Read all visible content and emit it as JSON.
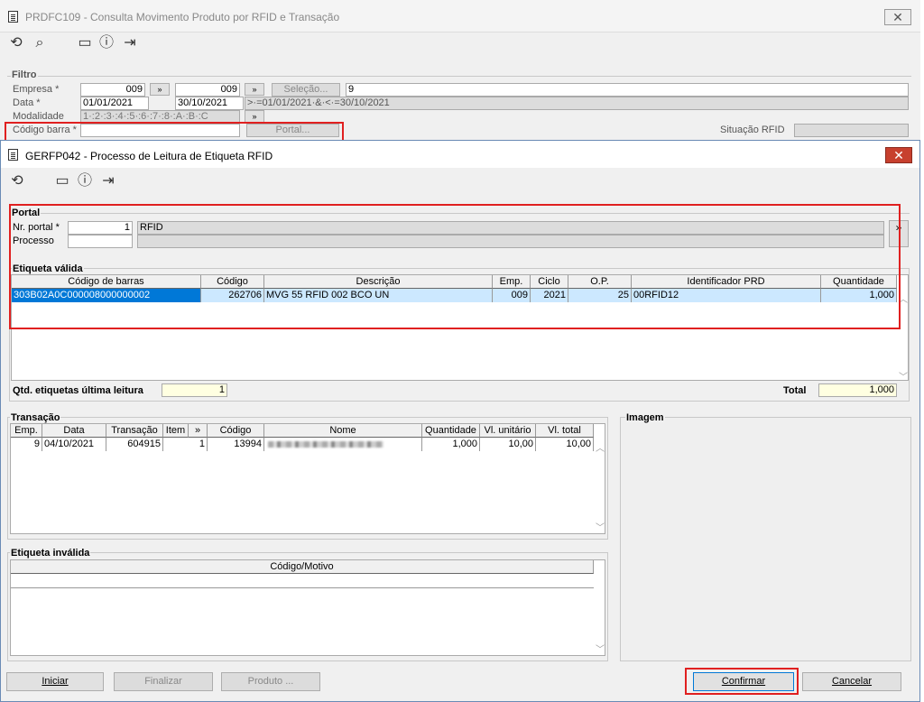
{
  "back_window": {
    "title": "PRDFC109 - Consulta Movimento Produto por RFID e Transação",
    "close_glyph": "✕",
    "filter": {
      "group_title": "Filtro",
      "empresa_label": "Empresa *",
      "empresa_from": "009",
      "empresa_to": "009",
      "data_label": "Data *",
      "data_from": "01/01/2021",
      "data_to": "30/10/2021",
      "modalidade_label": "Modalidade",
      "modalidade_value": "1·:2·:3·:4·:5·:6·:7·:8·:A·:B·:C",
      "codigo_barra_label": "Código barra *",
      "codigo_barra_value": "",
      "selecao_button": "Seleção...",
      "selecao_value": "9",
      "date_expression": ">·=01/01/2021·&·<·=30/10/2021",
      "portal_button": "Portal...",
      "situacao_rfid_label": "Situação RFID",
      "situacao_rfid_value": ""
    }
  },
  "dialog": {
    "title": "GERFP042 - Processo de Leitura de Etiqueta RFID",
    "close_glyph": "✕",
    "portal": {
      "group_title": "Portal",
      "nr_portal_label": "Nr. portal *",
      "nr_portal_value": "1",
      "nr_portal_desc": "RFID",
      "processo_label": "Processo",
      "processo_value": "",
      "processo_desc": "",
      "nav_button": "»"
    },
    "etiqueta_valida": {
      "group_title": "Etiqueta válida",
      "columns": [
        "Código de barras",
        "Código",
        "Descrição",
        "Emp.",
        "Ciclo",
        "O.P.",
        "Identificador PRD",
        "Quantidade"
      ],
      "rows": [
        [
          "303B02A0C000008000000002",
          "262706",
          "MVG 55 RFID 002 BCO UN",
          "009",
          "2021",
          "25",
          "00RFID12",
          "1,000"
        ]
      ],
      "qtd_label": "Qtd. etiquetas última leitura",
      "qtd_value": "1",
      "total_label": "Total",
      "total_value": "1,000"
    },
    "transacao": {
      "group_title": "Transação",
      "columns": [
        "Emp.",
        "Data",
        "Transação",
        "Item",
        "»",
        "Código",
        "Nome",
        "Quantidade",
        "Vl. unitário",
        "Vl. total"
      ],
      "rows": [
        [
          "9",
          "04/10/2021",
          "604915",
          "1",
          "",
          "13994",
          "",
          "1,000",
          "10,00",
          "10,00"
        ]
      ]
    },
    "imagem": {
      "group_title": "Imagem"
    },
    "etiqueta_invalida": {
      "group_title": "Etiqueta inválida",
      "columns": [
        "Código/Motivo"
      ]
    },
    "buttons": {
      "iniciar": "Iniciar",
      "finalizar": "Finalizar",
      "produto": "Produto ...",
      "confirmar": "Confirmar",
      "cancelar": "Cancelar"
    }
  }
}
